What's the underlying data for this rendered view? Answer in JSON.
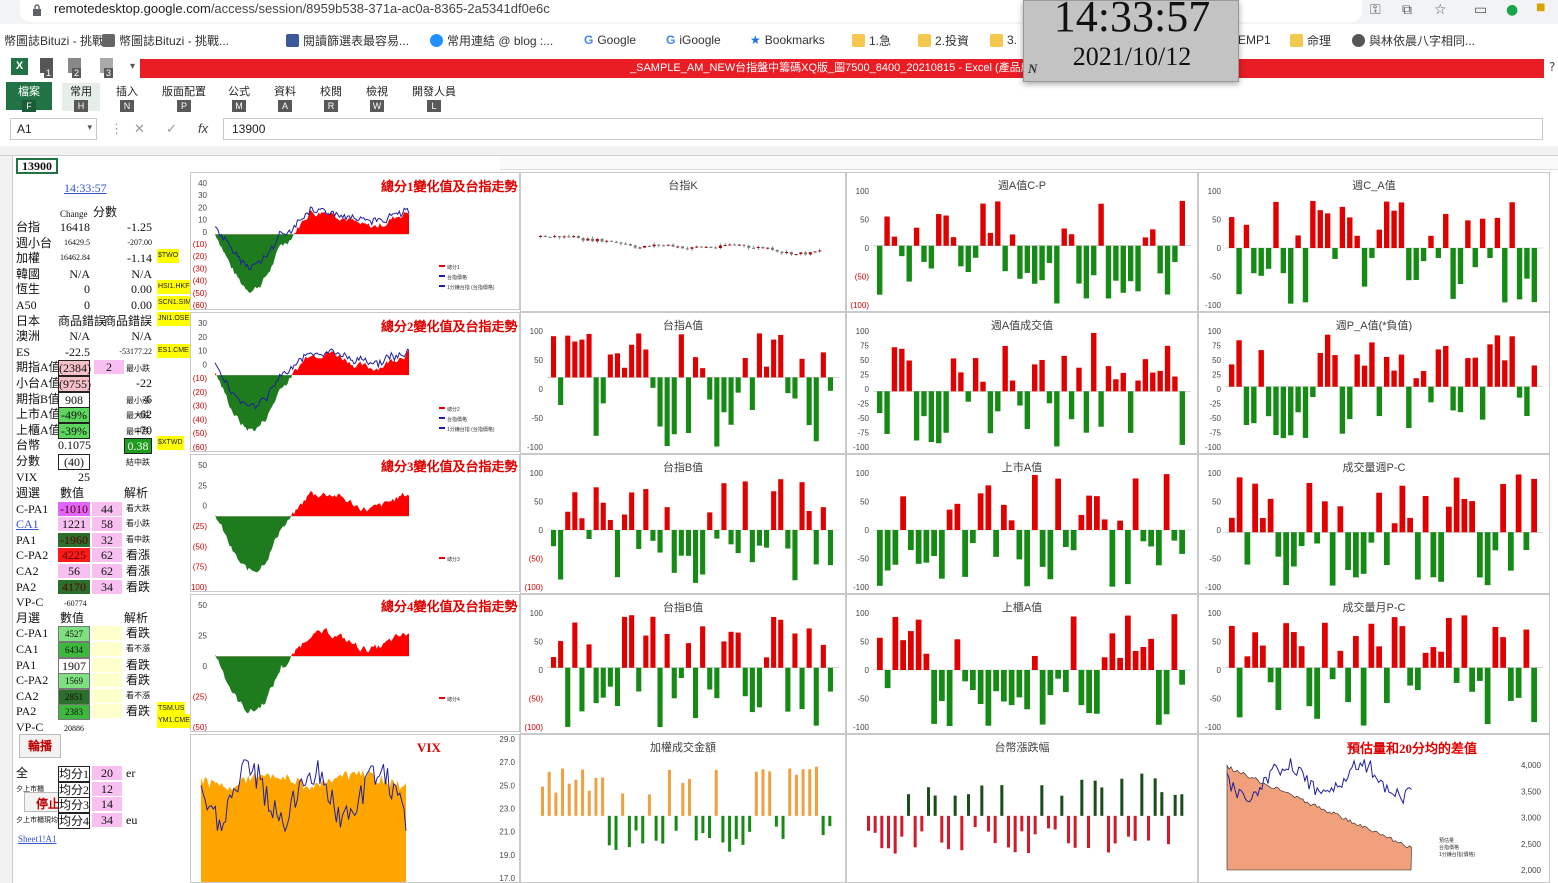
{
  "browser": {
    "url_host": "remotedesktop.google.com",
    "url_path": "/access/session/8959b538-371a-ac0a-8365-2a5341df0e6c",
    "bookmarks": [
      "幣圖誌Bituzi - 挑戰...",
      "幣圖誌Bituzi - 挑戰...",
      "閱讀篩選表最容易...",
      "常用連結 @ blog :...",
      "Google",
      "iGoogle",
      "Bookmarks",
      "1.急",
      "2.投資",
      "3.",
      "EMP1",
      "命理",
      "與林依晨八字相同..."
    ]
  },
  "clock": {
    "time": "14:33:57",
    "date": "2021/10/12",
    "corner": "N"
  },
  "excel": {
    "title": "_SAMPLE_AM_NEW台指盤中籌碼XQ版_圖7500_8400_20210815 - Excel (產品啟動失敗)",
    "tabs": [
      {
        "label": "檔案",
        "key": "F"
      },
      {
        "label": "常用",
        "key": "H"
      },
      {
        "label": "插入",
        "key": "N"
      },
      {
        "label": "版面配置",
        "key": "P"
      },
      {
        "label": "公式",
        "key": "M"
      },
      {
        "label": "資料",
        "key": "A"
      },
      {
        "label": "校閱",
        "key": "R"
      },
      {
        "label": "檢視",
        "key": "W"
      },
      {
        "label": "開發人員",
        "key": "L"
      }
    ],
    "qat_keys": [
      "1",
      "2",
      "3"
    ],
    "name_box": "A1",
    "formula_value": "13900",
    "fx_label": "fx"
  },
  "sheet": {
    "a1": "13900",
    "time": "14:33:57",
    "col_change": "Change",
    "col_score": "分數",
    "rows": [
      {
        "label": "台指",
        "v1": "16418",
        "v2": "-1.25"
      },
      {
        "label": "週小台",
        "v1": "16429.5",
        "v2": "-207.00"
      },
      {
        "label": "加權",
        "v1": "16462.84",
        "v2": "-1.14",
        "tag": "$TWO"
      },
      {
        "label": "韓國",
        "v1": "N/A",
        "v2": "N/A"
      },
      {
        "label": "恆生",
        "v1": "0",
        "v2": "0.00",
        "tag": "HSI1.HKF6"
      },
      {
        "label": "A50",
        "v1": "0",
        "v2": "0.00",
        "tag": "SCN1.SIMEX"
      },
      {
        "label": "日本",
        "v1": "商品錯誤",
        "v2": "商品錯誤",
        "tag": "JNI1.OSE"
      },
      {
        "label": "澳洲",
        "v1": "N/A",
        "v2": "N/A"
      },
      {
        "label": "ES",
        "v1": "-22.5",
        "v2": "-53177.22"
      },
      {
        "label": "期指A值",
        "v1": "(2384)",
        "v2": "2",
        "note": "最小跌"
      },
      {
        "label": "小台A值",
        "v1": "(9755)",
        "v2": "-22"
      },
      {
        "label": "期指B值",
        "v1": "908",
        "v2": "-6",
        "note": "最小漲"
      },
      {
        "label": "上市A值",
        "v1": "-49%",
        "v2": "-62",
        "note": "最大跌"
      },
      {
        "label": "上櫃A值",
        "v1": "-39%",
        "v2": "-70",
        "note": "最中跌"
      },
      {
        "label": "台幣",
        "v1": "0.1075",
        "v2": "0.38",
        "tag": "$XTWD"
      },
      {
        "label": "分數",
        "v1": "(40)",
        "v2": "",
        "note": "結中跌"
      },
      {
        "label": "VIX",
        "v1": "25",
        "v2": ""
      }
    ],
    "week": {
      "header": [
        "週選",
        "數值",
        "",
        "解析"
      ],
      "rows": [
        {
          "label": "C-PA1",
          "v1": "-1010",
          "v2": "44",
          "note": "看大跌"
        },
        {
          "label": "CA1",
          "v1": "1221",
          "v2": "58",
          "note": "看小跌"
        },
        {
          "label": "PA1",
          "v1": "-1960",
          "v2": "32",
          "note": "看中跌"
        },
        {
          "label": "C-PA2",
          "v1": "4225",
          "v2": "62",
          "note": "看漲"
        },
        {
          "label": "CA2",
          "v1": "56",
          "v2": "62",
          "note": "看漲"
        },
        {
          "label": "PA2",
          "v1": "4170",
          "v2": "34",
          "note": "看跌"
        }
      ],
      "vp": {
        "label": "VP-C",
        "value": "-60774"
      }
    },
    "month": {
      "header": [
        "月選",
        "數值",
        "",
        "解析"
      ],
      "rows": [
        {
          "label": "C-PA1",
          "v1": "4527",
          "note": "看跌"
        },
        {
          "label": "CA1",
          "v1": "6434",
          "note": "看不漲"
        },
        {
          "label": "PA1",
          "v1": "1907",
          "note": "看跌"
        },
        {
          "label": "C-PA2",
          "v1": "1569",
          "note": "看跌"
        },
        {
          "label": "CA2",
          "v1": "2851",
          "note": "看不漲"
        },
        {
          "label": "PA2",
          "v1": "2383",
          "note": "看跌",
          "tag": "TSM.US"
        }
      ],
      "vp": {
        "label": "VP-C",
        "value": "20886",
        "tag": "YM1.CME"
      }
    },
    "buttons": {
      "rotate": "輪播",
      "stop": "停止",
      "sheet_link": "Sheet1!A1"
    },
    "bottom": [
      {
        "label": "全",
        "btn": "均分1",
        "v": "20",
        "u": "er"
      },
      {
        "label": "夕上市櫃",
        "btn": "均分2",
        "v": "12",
        "u": ""
      },
      {
        "label": "",
        "btn": "均分3",
        "v": "14",
        "u": ""
      },
      {
        "label": "夕上市櫃現均",
        "btn": "均分4",
        "v": "34",
        "u": "eu"
      }
    ],
    "tags_extra": {
      "es": "ES1.CME"
    }
  },
  "charts": {
    "c1": {
      "title": "總分1變化值及台指走勢",
      "yticks": [
        "40",
        "30",
        "20",
        "10",
        "0",
        "(10)",
        "(20)",
        "(30)",
        "(40)",
        "(50)",
        "(60)"
      ],
      "legend": [
        "總分1",
        "台指價格",
        "1分鐘台指 (台指價格)"
      ]
    },
    "c2": {
      "title": "總分2變化值及台指走勢",
      "yticks": [
        "30",
        "20",
        "10",
        "0",
        "(10)",
        "(20)",
        "(30)",
        "(40)",
        "(50)",
        "(60)"
      ],
      "legend": [
        "總分2",
        "台指價格",
        "1分鐘台指 (台指價格)"
      ]
    },
    "c3": {
      "title": "總分3變化值及台指走勢",
      "yticks": [
        "50",
        "25",
        "0",
        "(25)",
        "(50)",
        "(75)",
        "(100)"
      ],
      "legend": [
        "總分3"
      ]
    },
    "c4": {
      "title": "總分4變化值及台指走勢",
      "yticks": [
        "50",
        "25",
        "0",
        "(25)",
        "(50)"
      ],
      "legend": [
        "總分4"
      ]
    },
    "vix": {
      "title": "VIX",
      "yticks": [
        "29.0",
        "27.0",
        "25.0",
        "23.0",
        "21.0",
        "19.0",
        "17.0"
      ]
    },
    "tx_k": {
      "title": "台指K"
    },
    "week_cp": {
      "title": "週A值C-P",
      "yticks": [
        "100",
        "50",
        "0",
        "(50)",
        "(100)"
      ]
    },
    "week_c": {
      "title": "週C_A值",
      "yticks": [
        "100",
        "50",
        "0",
        "-50",
        "-100"
      ]
    },
    "tx_a": {
      "title": "台指A值",
      "yticks": [
        "100",
        "50",
        "0",
        "-50",
        "-100"
      ]
    },
    "week_vol": {
      "title": "週A值成交值",
      "yticks": [
        "100",
        "75",
        "50",
        "25",
        "0",
        "-25",
        "-50",
        "-75",
        "-100"
      ]
    },
    "week_p": {
      "title": "週P_A值(*負值)",
      "yticks": [
        "100",
        "75",
        "50",
        "25",
        "0",
        "-25",
        "-50",
        "-75",
        "-100"
      ]
    },
    "tx_b": {
      "title": "台指B值",
      "yticks": [
        "100",
        "50",
        "0",
        "(50)",
        "(100)"
      ]
    },
    "listed_a": {
      "title": "上市A值",
      "yticks": [
        "100",
        "50",
        "0",
        "-50",
        "-100"
      ]
    },
    "week_vpc": {
      "title": "成交量週P-C",
      "yticks": [
        "100",
        "50",
        "0",
        "-50",
        "-100"
      ]
    },
    "tx_b2": {
      "title": "台指B值",
      "yticks": [
        "100",
        "50",
        "0",
        "(50)",
        "(100)"
      ]
    },
    "otc_a": {
      "title": "上櫃A值",
      "yticks": [
        "100",
        "50",
        "0",
        "-50",
        "-100"
      ]
    },
    "month_vpc": {
      "title": "成交量月P-C",
      "yticks": [
        "100",
        "50",
        "0",
        "-50",
        "-100"
      ]
    },
    "wt_vol": {
      "title": "加權成交金額"
    },
    "twd": {
      "title": "台幣漲跌幅"
    },
    "est": {
      "title": "預估量和20分均的差值",
      "yticks": [
        "4,000",
        "3,500",
        "3,000",
        "2,500",
        "2,000"
      ],
      "legend": [
        "預估量",
        "台指價格",
        "1分鐘台指(價格)"
      ]
    }
  },
  "colors": {
    "up": "#e00000",
    "down": "#158a15",
    "bull": "#ff0000",
    "bear": "#1e7b1e",
    "vix": "#ffa500",
    "line": "#1f1f9e",
    "accent": "#217346"
  }
}
